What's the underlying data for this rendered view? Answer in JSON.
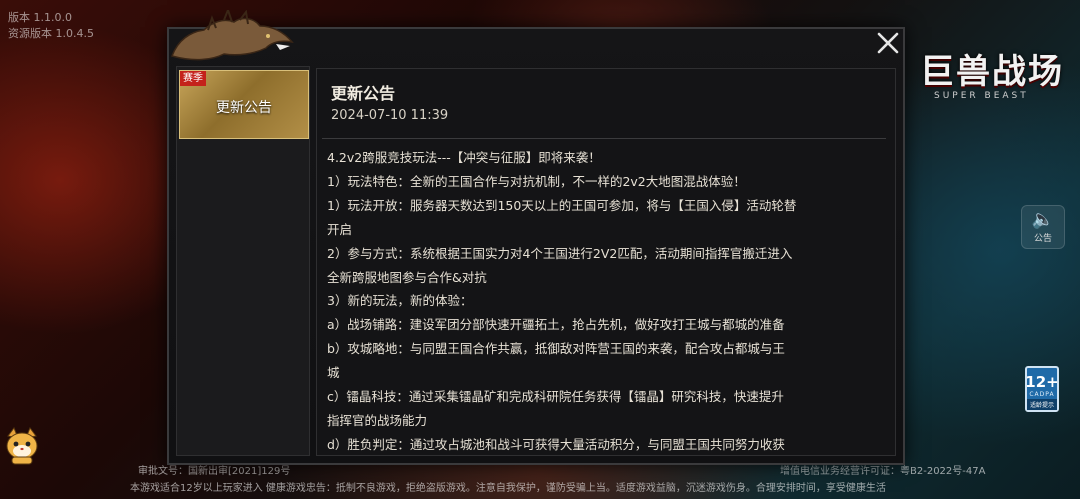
{
  "version_info": {
    "line1": "版本 1.1.0.0",
    "line2": "资源版本 1.0.4.5"
  },
  "game_logo": {
    "title_cn": "巨兽战场",
    "title_en": "SUPER BEAST"
  },
  "announce_button": {
    "label": "公告"
  },
  "age_badge": {
    "age": "12+",
    "org": "CADPA",
    "text": "适龄提示"
  },
  "modal": {
    "tabs": [
      {
        "label": "更新公告",
        "tag": "赛季"
      }
    ],
    "notice": {
      "title": "更新公告",
      "date": "2024-07-10 11:39",
      "lines": [
        "4.2v2跨服竞技玩法---【冲突与征服】即将来袭！",
        "1）玩法特色：全新的王国合作与对抗机制，不一样的2v2大地图混战体验！",
        "1）玩法开放：服务器天数达到150天以上的王国可参加，将与【王国入侵】活动轮替",
        "开启",
        "2）参与方式：系统根据王国实力对4个王国进行2V2匹配，活动期间指挥官搬迁进入",
        "全新跨服地图参与合作&对抗",
        "3）新的玩法，新的体验：",
        "a）战场铺路：建设军团分部快速开疆拓土，抢占先机，做好攻打王城与都城的准备",
        "b）攻城略地：与同盟王国合作共赢，抵御敌对阵营王国的来袭，配合攻占都城与王",
        "城",
        "c）镭晶科技：通过采集镭晶矿和完成科研院任务获得【镭晶】研究科技，快速提升",
        "指挥官的战场能力",
        "d）胜负判定：通过攻占城池和战斗可获得大量活动积分，与同盟王国共同努力收获"
      ]
    }
  },
  "footer": {
    "line1": "审批文号：国新出审[2021]129号",
    "line1b": "增值电信业务经营许可证：粤B2-2022号-47A",
    "line2": "本游戏适合12岁以上玩家进入 健康游戏忠告：抵制不良游戏，拒绝盗版游戏。注意自我保护，谨防受骗上当。适度游戏益脑，沉迷游戏伤身。合理安排时间，享受健康生活"
  }
}
